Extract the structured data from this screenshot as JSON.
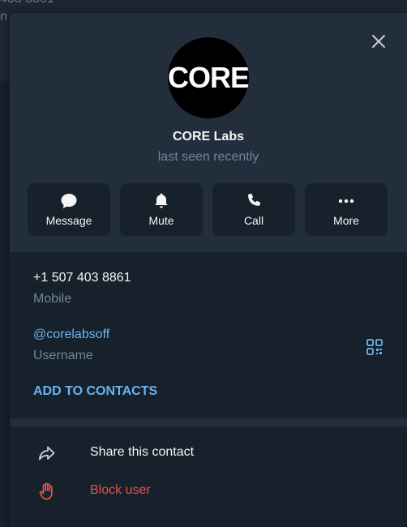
{
  "background": {
    "partial_line_1": "403 8861",
    "partial_line_2": "n"
  },
  "profile": {
    "avatar_text": "CORE",
    "name": "CORE Labs",
    "status": "last seen recently"
  },
  "actions": [
    {
      "label": "Message",
      "icon": "chat-bubble-icon"
    },
    {
      "label": "Mute",
      "icon": "bell-icon"
    },
    {
      "label": "Call",
      "icon": "phone-icon"
    },
    {
      "label": "More",
      "icon": "ellipsis-icon"
    }
  ],
  "info": {
    "phone": "+1 507 403 8861",
    "phone_label": "Mobile",
    "username": "@corelabsoff",
    "username_label": "Username",
    "add_contacts": "ADD TO CONTACTS"
  },
  "menu": {
    "share": "Share this contact",
    "block": "Block user"
  },
  "colors": {
    "panel_bg": "#17212b",
    "header_bg": "#232e3c",
    "accent": "#6ab3f3",
    "danger": "#e5534b",
    "muted": "#708499",
    "text": "#f5f5f5"
  }
}
